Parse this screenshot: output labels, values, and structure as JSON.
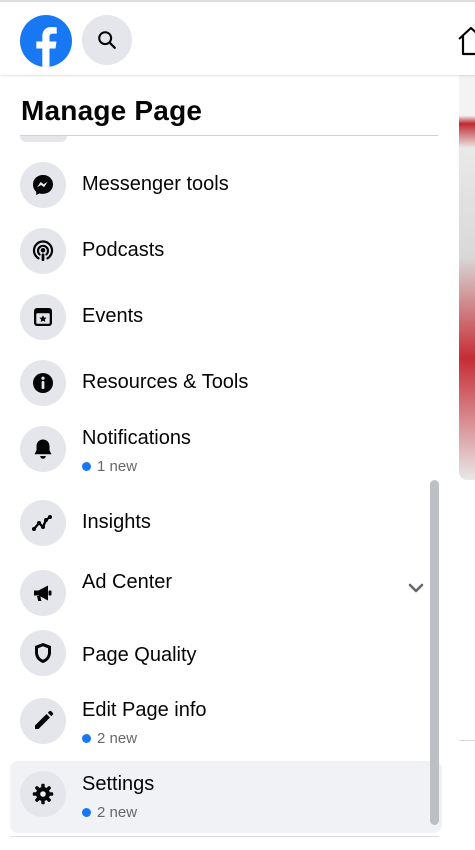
{
  "header": {
    "logo_icon": "facebook-logo",
    "search_icon": "search-icon",
    "home_icon": "home-icon",
    "brand_color": "#1877f2"
  },
  "panel": {
    "title": "Manage Page",
    "items": [
      {
        "label": "Messenger tools",
        "icon": "messenger-icon",
        "sub": ""
      },
      {
        "label": "Podcasts",
        "icon": "podcast-icon",
        "sub": ""
      },
      {
        "label": "Events",
        "icon": "calendar-star-icon",
        "sub": ""
      },
      {
        "label": "Resources & Tools",
        "icon": "info-icon",
        "sub": ""
      },
      {
        "label": "Notifications",
        "icon": "bell-icon",
        "sub": "1 new"
      },
      {
        "label": "Insights",
        "icon": "trend-line-icon",
        "sub": ""
      },
      {
        "label": "Ad Center",
        "icon": "megaphone-icon",
        "sub": "",
        "expandable": true
      },
      {
        "label": "Page Quality",
        "icon": "shield-icon",
        "sub": ""
      },
      {
        "label": "Edit Page info",
        "icon": "pencil-icon",
        "sub": "2 new"
      },
      {
        "label": "Settings",
        "icon": "gear-icon",
        "sub": "2 new",
        "active": true
      }
    ]
  }
}
